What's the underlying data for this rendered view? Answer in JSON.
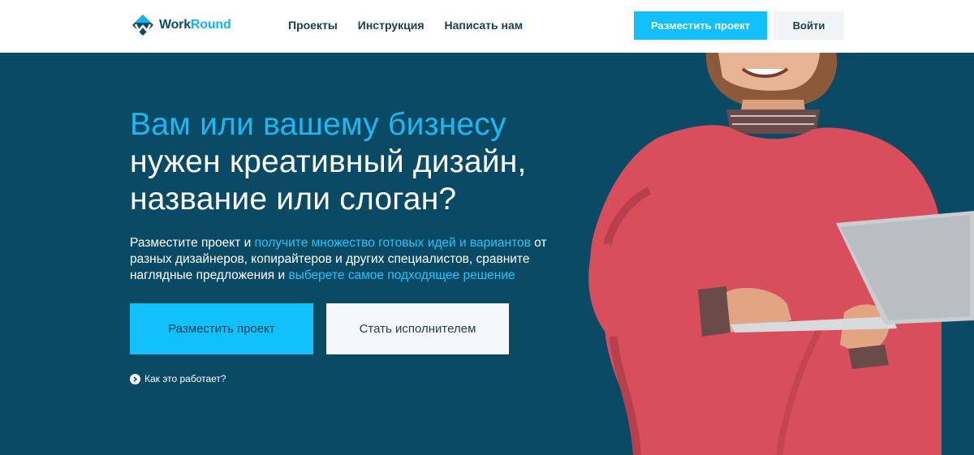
{
  "header": {
    "logo": {
      "part1": "Work",
      "part2": "Round"
    },
    "nav": [
      {
        "label": "Проекты"
      },
      {
        "label": "Инструкция"
      },
      {
        "label": "Написать нам"
      }
    ],
    "post_project_label": "Разместить проект",
    "login_label": "Войти"
  },
  "hero": {
    "headline_accent": "Вам или вашему бизнесу",
    "headline_line2": "нужен креативный дизайн,",
    "headline_line3": "название или слоган?",
    "lead": {
      "t1": "Разместите проект и ",
      "a1": "получите множество готовых идей и вариантов",
      "t2": " от разных дизайнеров, копирайтеров и других специалистов, сравните наглядные предложения и ",
      "a2": "выберете самое подходящее решение"
    },
    "post_project_label": "Разместить проект",
    "become_freelancer_label": "Стать исполнителем",
    "how_it_works_label": "Как это работает?"
  },
  "colors": {
    "brand_dark": "#0b4a64",
    "accent": "#12c0fb",
    "light_button": "#f5f8fb"
  },
  "icons": [
    "workround-logo-icon",
    "chevron-right-icon"
  ],
  "image": {
    "subject": "smiling man in red sweater holding laptop"
  }
}
